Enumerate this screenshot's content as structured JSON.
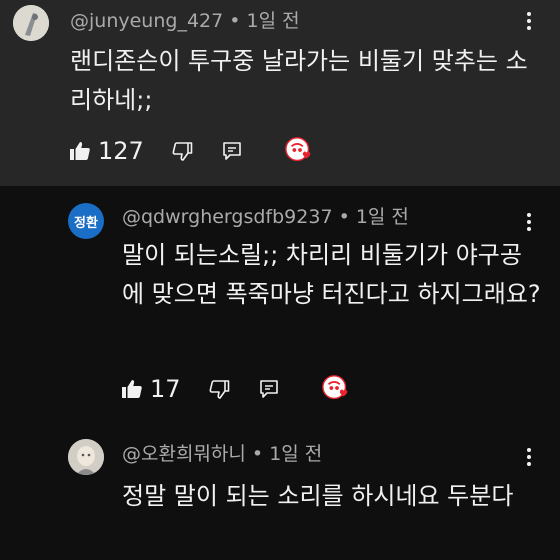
{
  "comments": [
    {
      "author": "@junyeung_427",
      "time": "1일 전",
      "text": "랜디존슨이 투구중 날라가는 비둘기 맞추는 소리하네;;",
      "likes": "127"
    },
    {
      "author": "@qdwrghergsdfb9237",
      "time": "1일 전",
      "avatar_text": "정환",
      "text": "말이 되는소릴;; 차리리 비둘기가 야구공에 맞으면 폭죽마냥 터진다고 하지그래요?",
      "likes": "17"
    },
    {
      "author": "@오환희뭐하니",
      "time": "1일 전",
      "text": "정말 말이 되는 소리를 하시네요 두분다"
    }
  ],
  "separator": " • ",
  "icons": {
    "like": "thumbs-up-icon",
    "dislike": "thumbs-down-icon",
    "reply": "reply-icon",
    "creator_heart": "creator-heart-icon",
    "more": "more-vertical-icon"
  },
  "colors": {
    "highlight_bg": "#272727",
    "bg": "#0f0f0f",
    "text": "#f1f1f1",
    "meta": "#aaaaaa",
    "heart": "#e8232f",
    "avatar_blue": "#1b6ec5"
  }
}
